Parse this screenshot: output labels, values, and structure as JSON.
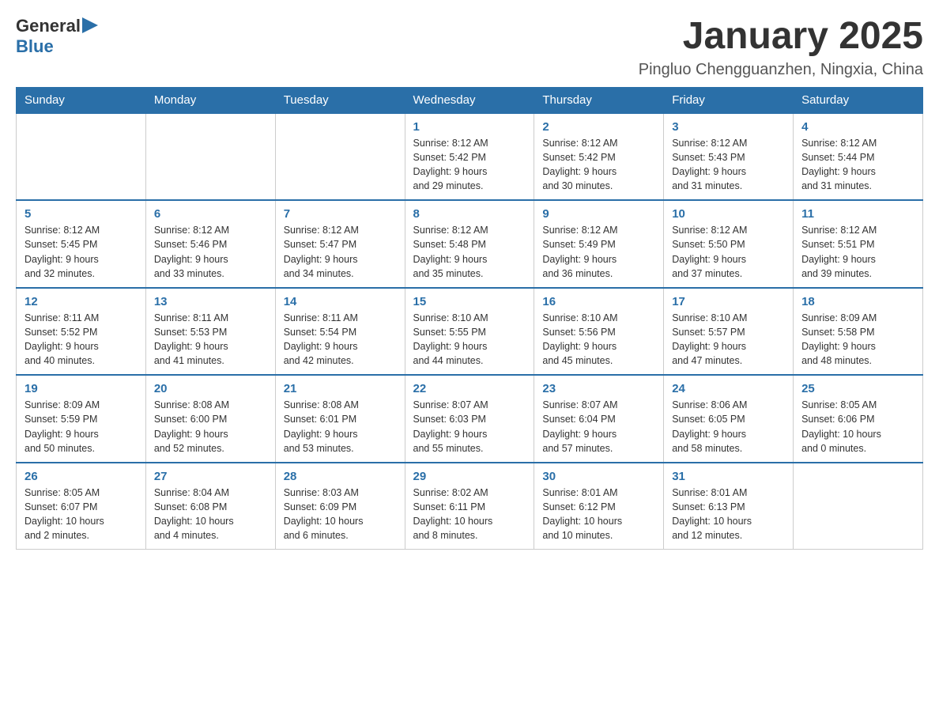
{
  "header": {
    "logo_general": "General",
    "logo_blue": "Blue",
    "month_title": "January 2025",
    "location": "Pingluo Chengguanzhen, Ningxia, China"
  },
  "weekdays": [
    "Sunday",
    "Monday",
    "Tuesday",
    "Wednesday",
    "Thursday",
    "Friday",
    "Saturday"
  ],
  "weeks": [
    [
      {
        "day": "",
        "info": ""
      },
      {
        "day": "",
        "info": ""
      },
      {
        "day": "",
        "info": ""
      },
      {
        "day": "1",
        "info": "Sunrise: 8:12 AM\nSunset: 5:42 PM\nDaylight: 9 hours\nand 29 minutes."
      },
      {
        "day": "2",
        "info": "Sunrise: 8:12 AM\nSunset: 5:42 PM\nDaylight: 9 hours\nand 30 minutes."
      },
      {
        "day": "3",
        "info": "Sunrise: 8:12 AM\nSunset: 5:43 PM\nDaylight: 9 hours\nand 31 minutes."
      },
      {
        "day": "4",
        "info": "Sunrise: 8:12 AM\nSunset: 5:44 PM\nDaylight: 9 hours\nand 31 minutes."
      }
    ],
    [
      {
        "day": "5",
        "info": "Sunrise: 8:12 AM\nSunset: 5:45 PM\nDaylight: 9 hours\nand 32 minutes."
      },
      {
        "day": "6",
        "info": "Sunrise: 8:12 AM\nSunset: 5:46 PM\nDaylight: 9 hours\nand 33 minutes."
      },
      {
        "day": "7",
        "info": "Sunrise: 8:12 AM\nSunset: 5:47 PM\nDaylight: 9 hours\nand 34 minutes."
      },
      {
        "day": "8",
        "info": "Sunrise: 8:12 AM\nSunset: 5:48 PM\nDaylight: 9 hours\nand 35 minutes."
      },
      {
        "day": "9",
        "info": "Sunrise: 8:12 AM\nSunset: 5:49 PM\nDaylight: 9 hours\nand 36 minutes."
      },
      {
        "day": "10",
        "info": "Sunrise: 8:12 AM\nSunset: 5:50 PM\nDaylight: 9 hours\nand 37 minutes."
      },
      {
        "day": "11",
        "info": "Sunrise: 8:12 AM\nSunset: 5:51 PM\nDaylight: 9 hours\nand 39 minutes."
      }
    ],
    [
      {
        "day": "12",
        "info": "Sunrise: 8:11 AM\nSunset: 5:52 PM\nDaylight: 9 hours\nand 40 minutes."
      },
      {
        "day": "13",
        "info": "Sunrise: 8:11 AM\nSunset: 5:53 PM\nDaylight: 9 hours\nand 41 minutes."
      },
      {
        "day": "14",
        "info": "Sunrise: 8:11 AM\nSunset: 5:54 PM\nDaylight: 9 hours\nand 42 minutes."
      },
      {
        "day": "15",
        "info": "Sunrise: 8:10 AM\nSunset: 5:55 PM\nDaylight: 9 hours\nand 44 minutes."
      },
      {
        "day": "16",
        "info": "Sunrise: 8:10 AM\nSunset: 5:56 PM\nDaylight: 9 hours\nand 45 minutes."
      },
      {
        "day": "17",
        "info": "Sunrise: 8:10 AM\nSunset: 5:57 PM\nDaylight: 9 hours\nand 47 minutes."
      },
      {
        "day": "18",
        "info": "Sunrise: 8:09 AM\nSunset: 5:58 PM\nDaylight: 9 hours\nand 48 minutes."
      }
    ],
    [
      {
        "day": "19",
        "info": "Sunrise: 8:09 AM\nSunset: 5:59 PM\nDaylight: 9 hours\nand 50 minutes."
      },
      {
        "day": "20",
        "info": "Sunrise: 8:08 AM\nSunset: 6:00 PM\nDaylight: 9 hours\nand 52 minutes."
      },
      {
        "day": "21",
        "info": "Sunrise: 8:08 AM\nSunset: 6:01 PM\nDaylight: 9 hours\nand 53 minutes."
      },
      {
        "day": "22",
        "info": "Sunrise: 8:07 AM\nSunset: 6:03 PM\nDaylight: 9 hours\nand 55 minutes."
      },
      {
        "day": "23",
        "info": "Sunrise: 8:07 AM\nSunset: 6:04 PM\nDaylight: 9 hours\nand 57 minutes."
      },
      {
        "day": "24",
        "info": "Sunrise: 8:06 AM\nSunset: 6:05 PM\nDaylight: 9 hours\nand 58 minutes."
      },
      {
        "day": "25",
        "info": "Sunrise: 8:05 AM\nSunset: 6:06 PM\nDaylight: 10 hours\nand 0 minutes."
      }
    ],
    [
      {
        "day": "26",
        "info": "Sunrise: 8:05 AM\nSunset: 6:07 PM\nDaylight: 10 hours\nand 2 minutes."
      },
      {
        "day": "27",
        "info": "Sunrise: 8:04 AM\nSunset: 6:08 PM\nDaylight: 10 hours\nand 4 minutes."
      },
      {
        "day": "28",
        "info": "Sunrise: 8:03 AM\nSunset: 6:09 PM\nDaylight: 10 hours\nand 6 minutes."
      },
      {
        "day": "29",
        "info": "Sunrise: 8:02 AM\nSunset: 6:11 PM\nDaylight: 10 hours\nand 8 minutes."
      },
      {
        "day": "30",
        "info": "Sunrise: 8:01 AM\nSunset: 6:12 PM\nDaylight: 10 hours\nand 10 minutes."
      },
      {
        "day": "31",
        "info": "Sunrise: 8:01 AM\nSunset: 6:13 PM\nDaylight: 10 hours\nand 12 minutes."
      },
      {
        "day": "",
        "info": ""
      }
    ]
  ]
}
